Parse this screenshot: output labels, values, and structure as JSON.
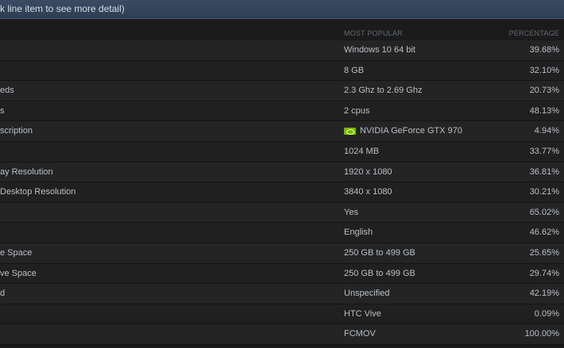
{
  "header": {
    "text": "k line item to see more detail)"
  },
  "columns": {
    "most_popular": "MOST POPULAR",
    "percentage": "PERCENTAGE"
  },
  "rows": [
    {
      "name": "",
      "value": "Windows 10 64 bit",
      "pct": "39.68%"
    },
    {
      "name": "",
      "value": "8 GB",
      "pct": "32.10%"
    },
    {
      "name": "eds",
      "value": "2.3 Ghz to 2.69 Ghz",
      "pct": "20.73%"
    },
    {
      "name": "s",
      "value": "2 cpus",
      "pct": "48.13%"
    },
    {
      "name": "scription",
      "value": "NVIDIA GeForce GTX 970",
      "pct": "4.94%",
      "icon": "nvidia-logo-icon"
    },
    {
      "name": "",
      "value": "1024 MB",
      "pct": "33.77%"
    },
    {
      "name": "ay Resolution",
      "value": "1920 x 1080",
      "pct": "36.81%"
    },
    {
      "name": "Desktop Resolution",
      "value": "3840 x 1080",
      "pct": "30.21%"
    },
    {
      "name": "",
      "value": "Yes",
      "pct": "65.02%"
    },
    {
      "name": "",
      "value": "English",
      "pct": "46.62%"
    },
    {
      "name": "e Space",
      "value": "250 GB to 499 GB",
      "pct": "25.65%"
    },
    {
      "name": "ve Space",
      "value": "250 GB to 499 GB",
      "pct": "29.74%"
    },
    {
      "name": "d",
      "value": "Unspecified",
      "pct": "42.19%"
    },
    {
      "name": "",
      "value": "HTC Vive",
      "pct": "0.09%"
    },
    {
      "name": "",
      "value": "FCMOV",
      "pct": "100.00%"
    }
  ],
  "colors": {
    "nvidia_green": "#76b900",
    "background": "#1b1b1b",
    "header": "#34455a"
  }
}
